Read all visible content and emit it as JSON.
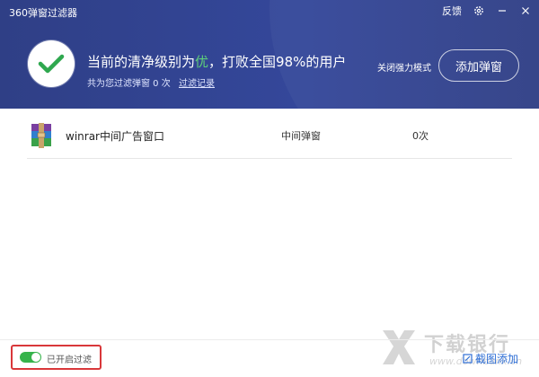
{
  "window": {
    "title": "360弹窗过滤器",
    "feedback_label": "反馈"
  },
  "status": {
    "prefix": "当前的清净级别为",
    "level": "优",
    "suffix": "，打败全国98%的用户",
    "filtered_text": "共为您过滤弹窗 0 次",
    "history_link": "过滤记录"
  },
  "actions": {
    "force_mode": "关闭强力模式",
    "add_button": "添加弹窗"
  },
  "rows": [
    {
      "name": "winrar中间广告窗口",
      "type": "中间弹窗",
      "count": "0次"
    }
  ],
  "footer": {
    "filter_label": "已开启过滤",
    "filter_on": true,
    "screenshot_add": "截图添加"
  },
  "watermark": {
    "name": "下载银行",
    "url": "www.downbank.cn"
  },
  "colors": {
    "header": "#34479a",
    "accent_green": "#36b34b",
    "highlight_box": "#d9373a",
    "link_blue": "#2f6fd6"
  }
}
